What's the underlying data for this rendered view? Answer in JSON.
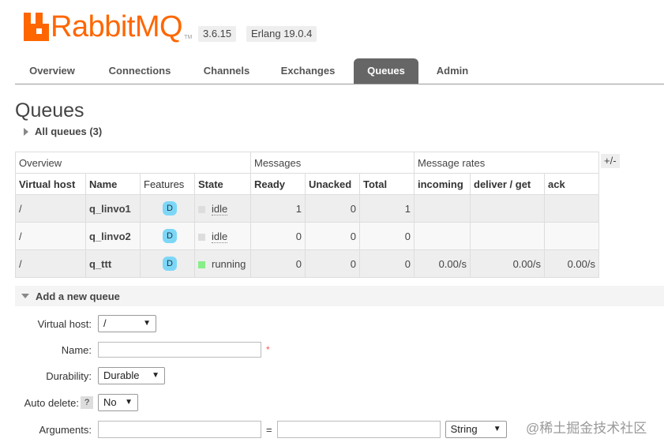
{
  "header": {
    "logo_text": "RabbitMQ",
    "logo_tm": "TM",
    "version_badge": "3.6.15",
    "erlang_badge": "Erlang 19.0.4"
  },
  "tabs": [
    {
      "label": "Overview",
      "active": false
    },
    {
      "label": "Connections",
      "active": false
    },
    {
      "label": "Channels",
      "active": false
    },
    {
      "label": "Exchanges",
      "active": false
    },
    {
      "label": "Queues",
      "active": true
    },
    {
      "label": "Admin",
      "active": false
    }
  ],
  "page": {
    "title": "Queues",
    "all_queues": "All queues (3)"
  },
  "table": {
    "groups": [
      "Overview",
      "Messages",
      "Message rates"
    ],
    "columns": [
      "Virtual host",
      "Name",
      "Features",
      "State",
      "Ready",
      "Unacked",
      "Total",
      "incoming",
      "deliver / get",
      "ack"
    ],
    "toggle": "+/-",
    "rows": [
      {
        "vhost": "/",
        "name": "q_linvo1",
        "feature": "D",
        "state": "idle",
        "ready": "1",
        "unacked": "0",
        "total": "1",
        "incoming": "",
        "deliver": "",
        "ack": ""
      },
      {
        "vhost": "/",
        "name": "q_linvo2",
        "feature": "D",
        "state": "idle",
        "ready": "0",
        "unacked": "0",
        "total": "0",
        "incoming": "",
        "deliver": "",
        "ack": ""
      },
      {
        "vhost": "/",
        "name": "q_ttt",
        "feature": "D",
        "state": "running",
        "ready": "0",
        "unacked": "0",
        "total": "0",
        "incoming": "0.00/s",
        "deliver": "0.00/s",
        "ack": "0.00/s"
      }
    ]
  },
  "add_queue": {
    "heading": "Add a new queue",
    "vhost_label": "Virtual host:",
    "vhost_value": "/",
    "name_label": "Name:",
    "name_value": "",
    "required_mark": "*",
    "durability_label": "Durability:",
    "durability_value": "Durable",
    "auto_delete_label": "Auto delete:",
    "auto_delete_help": "?",
    "auto_delete_value": "No",
    "arguments_label": "Arguments:",
    "arguments_eq": "=",
    "arguments_type": "String"
  },
  "watermark": "@稀土掘金技术社区"
}
